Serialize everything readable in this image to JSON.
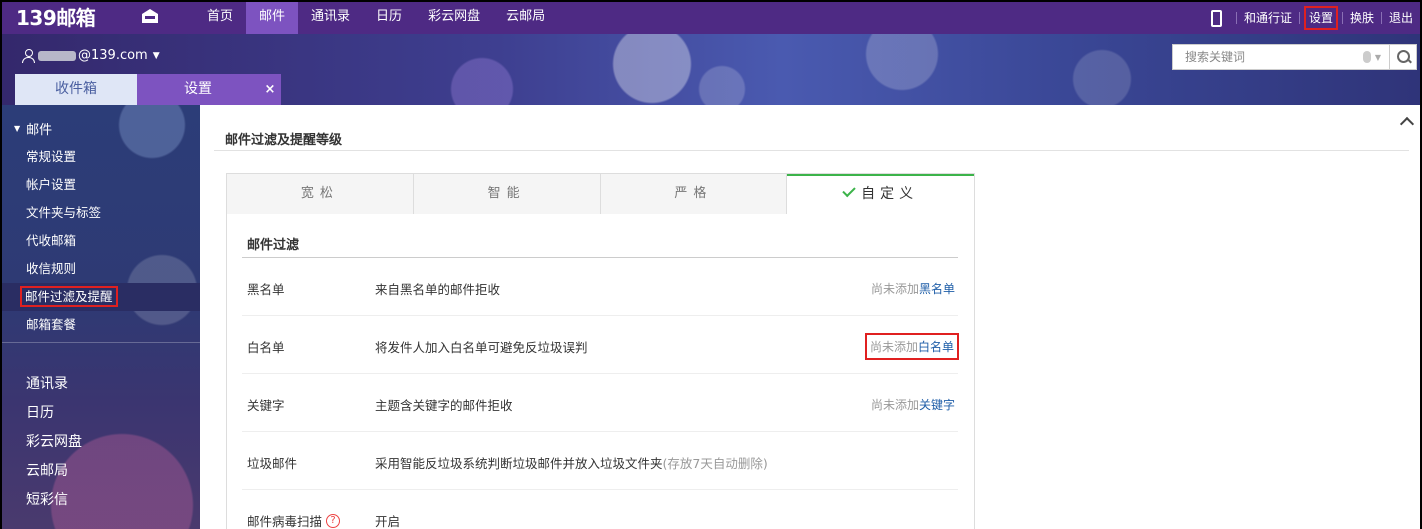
{
  "topbar": {
    "logo": "139邮箱",
    "nav": [
      "首页",
      "邮件",
      "通讯录",
      "日历",
      "彩云网盘",
      "云邮局"
    ],
    "nav_active_index": 1,
    "right": {
      "pass": "和通行证",
      "settings": "设置",
      "skin": "换肤",
      "logout": "退出"
    }
  },
  "header": {
    "user_suffix": "@139.com",
    "search_placeholder": "搜索关键词",
    "tabs": {
      "inbox": "收件箱",
      "settings": "设置",
      "close": "×"
    }
  },
  "sidebar": {
    "group": "邮件",
    "items": [
      "常规设置",
      "帐户设置",
      "文件夹与标签",
      "代收邮箱",
      "收信规则",
      "邮件过滤及提醒",
      "邮箱套餐"
    ],
    "active_index": 5,
    "apps": [
      "通讯录",
      "日历",
      "彩云网盘",
      "云邮局",
      "短彩信"
    ]
  },
  "main": {
    "title": "邮件过滤及提醒等级",
    "level_tabs": [
      "宽松",
      "智能",
      "严格",
      "自定义"
    ],
    "active_level_index": 3,
    "section_title": "邮件过滤",
    "rows": [
      {
        "label": "黑名单",
        "desc": "来自黑名单的邮件拒收",
        "action_pre": "尚未添加",
        "action_link": "黑名单"
      },
      {
        "label": "白名单",
        "desc": "将发件人加入白名单可避免反垃圾误判",
        "action_pre": "尚未添加",
        "action_link": "白名单"
      },
      {
        "label": "关键字",
        "desc": "主题含关键字的邮件拒收",
        "action_pre": "尚未添加",
        "action_link": "关键字"
      },
      {
        "label": "垃圾邮件",
        "desc": "采用智能反垃圾系统判断垃圾邮件并放入垃圾文件夹",
        "desc_muted": "(存放7天自动删除)"
      },
      {
        "label": "邮件病毒扫描",
        "help": "?",
        "desc": "开启"
      }
    ]
  },
  "colors": {
    "topbar": "#4e2a84",
    "accent_purple": "#7d53c0",
    "active_green": "#3cb34a",
    "link_blue": "#1f5ea8",
    "highlight_red": "#e02020"
  }
}
